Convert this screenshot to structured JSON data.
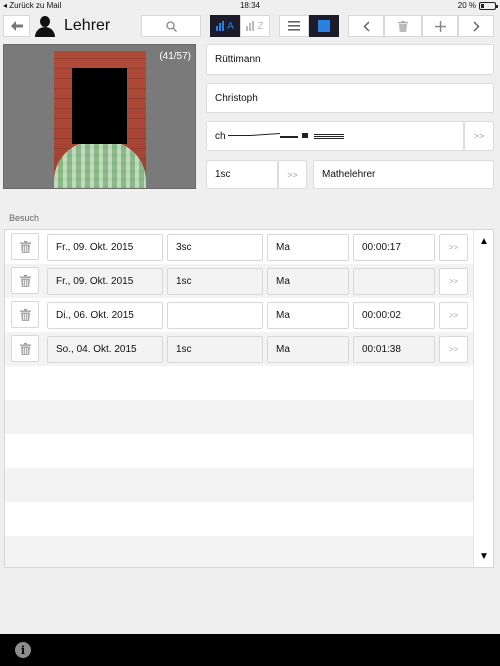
{
  "status_bar": {
    "back_to_app": "◂ Zurück zu Mail",
    "time": "18:34",
    "battery_percent_label": "20 %",
    "battery_level": 0.2
  },
  "toolbar": {
    "title": "Lehrer",
    "sort_az_label": "A",
    "sort_z_label": "Z",
    "icons": [
      "back-arrow-icon",
      "person-icon",
      "search-icon",
      "bar-chart-icon",
      "list-icon",
      "square-icon",
      "chevron-left-icon",
      "trash-icon",
      "plus-icon",
      "chevron-right-icon"
    ]
  },
  "profile": {
    "counter": "(41/57)",
    "last_name": "Rüttimann",
    "first_name": "Christoph",
    "email_prefix": "ch",
    "email_arrow": ">>",
    "class": "1sc",
    "class_arrow": ">>",
    "role": "Mathelehrer"
  },
  "visits": {
    "section_label": "Besuch",
    "rows": [
      {
        "date": "Fr., 09. Okt. 2015",
        "class": "3sc",
        "subject": "Ma",
        "duration": "00:00:17",
        "go": ">>"
      },
      {
        "date": "Fr., 09. Okt. 2015",
        "class": "1sc",
        "subject": "Ma",
        "duration": "",
        "go": ">>"
      },
      {
        "date": "Di., 06. Okt. 2015",
        "class": "",
        "subject": "Ma",
        "duration": "00:00:02",
        "go": ">>"
      },
      {
        "date": "So., 04. Okt. 2015",
        "class": "1sc",
        "subject": "Ma",
        "duration": "00:01:38",
        "go": ">>"
      }
    ],
    "scroll_up": "▲",
    "scroll_down": "▼"
  },
  "bottom_bar": {
    "info_label": "i"
  },
  "colors": {
    "accent_blue": "#2b7fe0",
    "toolbar_active_bg": "#1b1b2a",
    "background": "#efeff0",
    "bottom_bar": "#000000"
  }
}
